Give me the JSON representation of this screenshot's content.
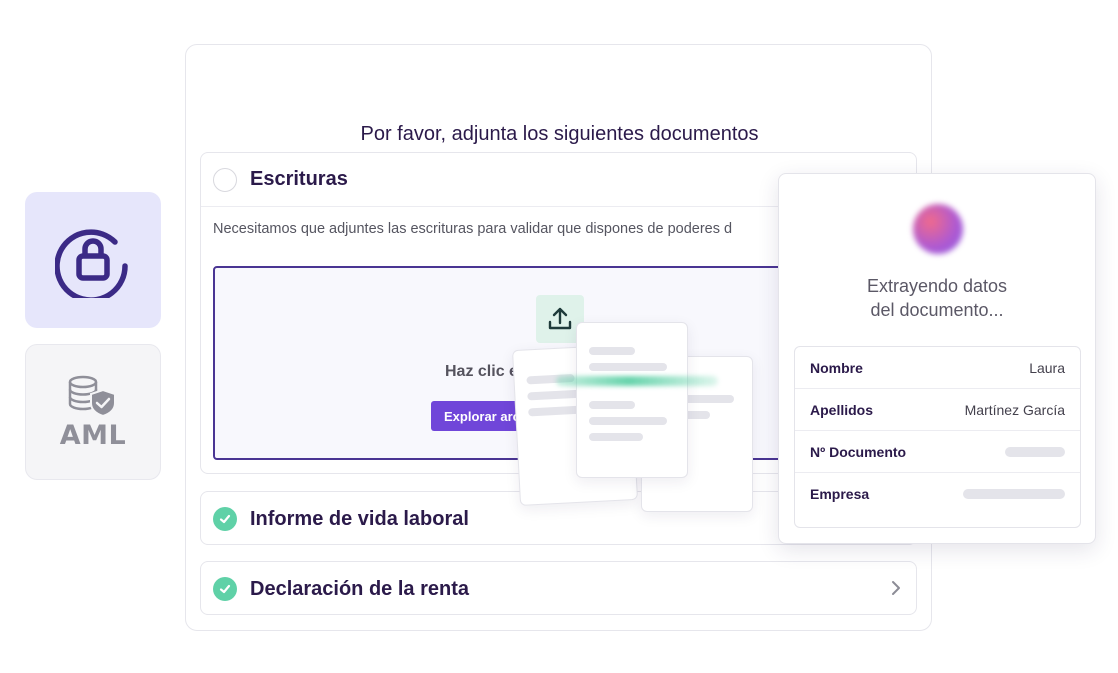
{
  "main": {
    "title": "Por favor, adjunta los siguientes documentos",
    "sections": [
      {
        "title": "Escrituras",
        "status": "pending",
        "description": "Necesitamos que adjuntes las escrituras para validar que dispones de poderes d",
        "dropzone": {
          "text": "Haz clic e",
          "button_label": "Explorar arc"
        }
      },
      {
        "title": "Informe de vida laboral",
        "status": "complete"
      },
      {
        "title": "Declaración de la renta",
        "status": "complete"
      }
    ]
  },
  "tiles": {
    "aml_label": "AML"
  },
  "extraction": {
    "title_line1": "Extrayendo datos",
    "title_line2": "del documento...",
    "fields": [
      {
        "label": "Nombre",
        "value": "Laura"
      },
      {
        "label": "Apellidos",
        "value": "Martínez García"
      },
      {
        "label": "Nº Documento",
        "value": ""
      },
      {
        "label": "Empresa",
        "value": ""
      }
    ]
  },
  "colors": {
    "brand_purple": "#7046d9",
    "dark_purple": "#4a3593",
    "success_green": "#5fd1a7",
    "text_dark": "#2b1a4a"
  }
}
